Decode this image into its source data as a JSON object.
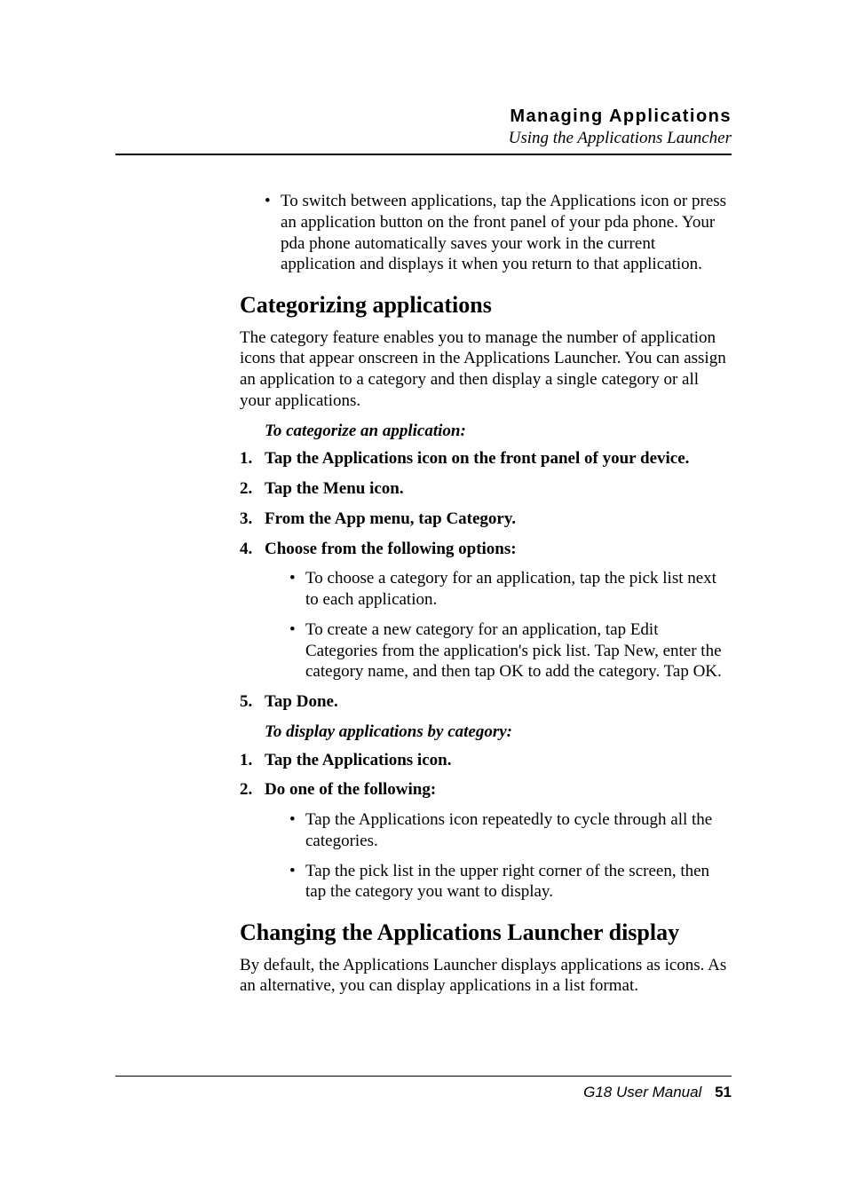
{
  "header": {
    "title": "Managing Applications",
    "subtitle": "Using the Applications Launcher"
  },
  "intro_bullet": "To switch between applications, tap the Applications icon or press an application button on the front panel of your pda phone. Your pda phone automatically saves your work in the current application and displays it when you return to that application.",
  "section1": {
    "heading": "Categorizing applications",
    "para": "The category feature enables you to manage the number of application icons that appear onscreen in the Applications Launcher. You can assign an application to a category and then display a single category or all your applications.",
    "procA_title": "To categorize an application:",
    "procA_steps": [
      "Tap the Applications icon on the front panel of your device.",
      "Tap the Menu icon.",
      "From the App menu, tap Category.",
      "Choose from the following options:"
    ],
    "procA_step4_bullets": [
      "To choose a category for an application, tap the pick list next to each application.",
      "To create a new category for an application, tap Edit Categories from the application's pick list. Tap New, enter the category name, and then tap OK to add the category. Tap OK."
    ],
    "procA_step5": "Tap Done.",
    "procB_title": "To display applications by category:",
    "procB_steps": [
      "Tap the Applications icon.",
      "Do one of the following:"
    ],
    "procB_step2_bullets": [
      "Tap the Applications icon repeatedly to cycle through all the categories.",
      "Tap the pick list in the upper right corner of the screen, then tap the category you want to display."
    ]
  },
  "section2": {
    "heading": "Changing the Applications Launcher display",
    "para": "By default, the Applications Launcher displays applications as icons. As an alternative, you can display applications in a list format."
  },
  "footer": {
    "manual": "G18 User Manual",
    "page": "51"
  }
}
